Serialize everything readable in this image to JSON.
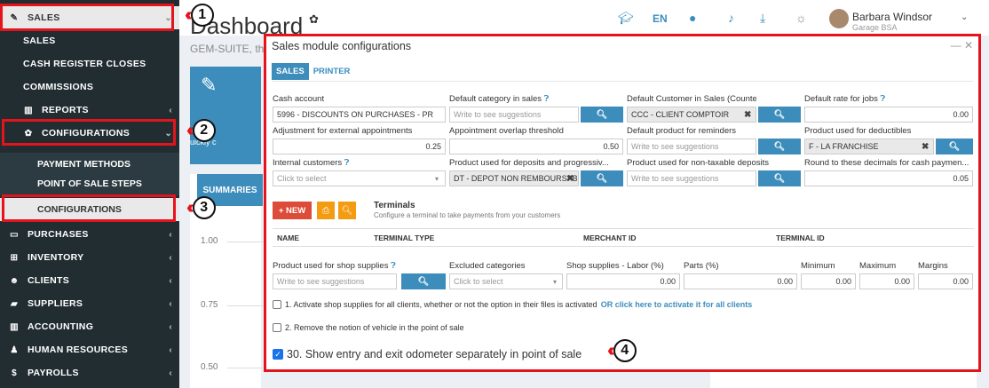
{
  "sidebar": {
    "sales": "SALES",
    "sales_sub": "SALES",
    "cash_register": "CASH REGISTER CLOSES",
    "commissions": "COMMISSIONS",
    "reports": "REPORTS",
    "configurations": "CONFIGURATIONS",
    "payment_methods": "PAYMENT METHODS",
    "pos_steps": "POINT OF SALE STEPS",
    "configurations_sub": "CONFIGURATIONS",
    "purchases": "PURCHASES",
    "inventory": "INVENTORY",
    "clients": "CLIENTS",
    "suppliers": "SUPPLIERS",
    "accounting": "ACCOUNTING",
    "hr": "HUMAN RESOURCES",
    "payrolls": "PAYROLLS"
  },
  "annotations": {
    "b1": "1",
    "b2": "2",
    "b3": "3",
    "b4": "4"
  },
  "header": {
    "title": "Dashboard",
    "subtitle": "GEM-SUITE, th",
    "lang": "EN",
    "user_name": "Barbara Windsor",
    "user_sub": "Garage BSA"
  },
  "background": {
    "quick": "uickly c",
    "summaries": "SUMMARIES",
    "axis": [
      "1.00",
      "0.75",
      "0.50"
    ]
  },
  "modal": {
    "title": "Sales module configurations",
    "tabs": [
      "SALES",
      "PRINTER"
    ],
    "row1": {
      "cash_account_label": "Cash account",
      "cash_account_value": "5996 - DISCOUNTS ON PURCHASES - PR",
      "default_category_label": "Default category in sales",
      "default_category_placeholder": "Write to see suggestions",
      "default_customer_label": "Default Customer in Sales (Counter)",
      "default_customer_value": "CCC - CLIENT COMPTOIR",
      "default_rate_label": "Default rate for jobs",
      "default_rate_value": "0.00"
    },
    "row2": {
      "adjustment_label": "Adjustment for external appointments",
      "adjustment_value": "0.25",
      "overlap_label": "Appointment overlap threshold",
      "overlap_value": "0.50",
      "reminders_label": "Default product for reminders",
      "reminders_placeholder": "Write to see suggestions",
      "deductibles_label": "Product used for deductibles",
      "deductibles_value": "F - LA FRANCHISE"
    },
    "row3": {
      "internal_label": "Internal customers",
      "internal_placeholder": "Click to select",
      "deposits_label": "Product used for deposits and progressiv...",
      "deposits_value": "DT - DEPOT NON REMBOURSAB",
      "nontax_label": "Product used for non-taxable deposits",
      "nontax_placeholder": "Write to see suggestions",
      "round_label": "Round to these decimals for cash paymen...",
      "round_value": "0.05"
    },
    "terminals": {
      "new_label": "+ NEW",
      "title": "Terminals",
      "subtitle": "Configure a terminal to take payments from your customers",
      "headers": [
        "NAME",
        "TERMINAL TYPE",
        "MERCHANT ID",
        "TERMINAL ID"
      ]
    },
    "row4": {
      "shop_supplies_label": "Product used for shop supplies",
      "shop_supplies_placeholder": "Write to see suggestions",
      "excluded_label": "Excluded categories",
      "excluded_placeholder": "Click to select",
      "labor_label": "Shop supplies - Labor (%)",
      "labor_value": "0.00",
      "parts_label": "Parts (%)",
      "parts_value": "0.00",
      "minimum_label": "Minimum",
      "minimum_value": "0.00",
      "maximum_label": "Maximum",
      "maximum_value": "0.00",
      "margins_label": "Margins",
      "margins_value": "0.00"
    },
    "options": {
      "opt1": "1. Activate shop supplies for all clients, whether or not the option in their files is activated",
      "opt1_link": "OR click here to activate it for all clients",
      "opt2": "2. Remove the notion of vehicle in the point of sale",
      "opt30": "30. Show entry and exit odometer separately in point of sale"
    }
  }
}
